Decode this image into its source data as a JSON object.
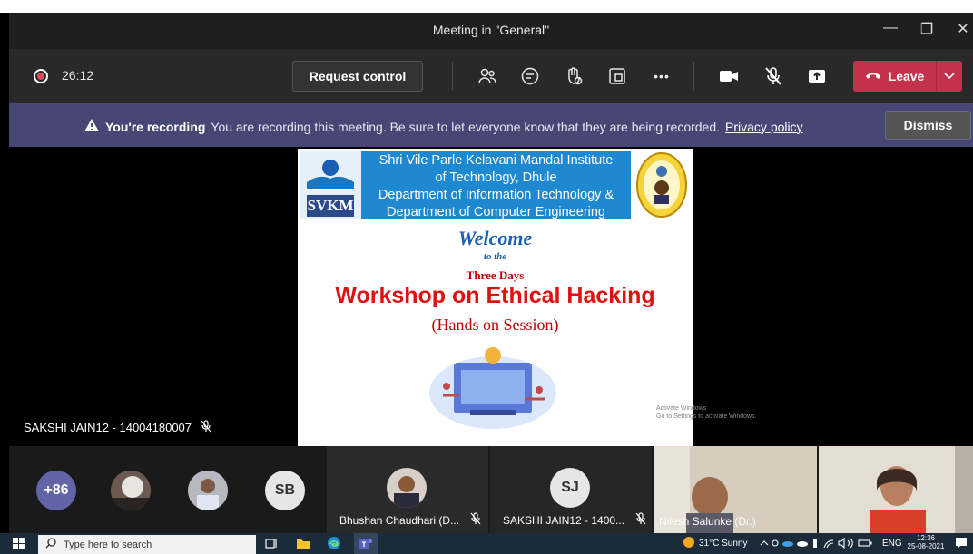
{
  "window": {
    "title": "Meeting in \"General\"",
    "minimize_glyph": "—",
    "maximize_glyph": "❐",
    "close_glyph": "✕"
  },
  "toolbar": {
    "timer": "26:12",
    "request_control_label": "Request control",
    "more_glyph": "•••",
    "leave_label": "Leave",
    "leave_color": "#c4314b",
    "icons": [
      "people-icon",
      "chat-icon",
      "raise-hand-icon",
      "rooms-icon",
      "more-actions-icon",
      "camera-icon",
      "mic-off-icon",
      "share-icon"
    ]
  },
  "recording_banner": {
    "title": "You're recording",
    "message": "You are recording this meeting. Be sure to let everyone know that they are being recorded.",
    "link": "Privacy policy",
    "dismiss_label": "Dismiss",
    "background": "#464775"
  },
  "slide": {
    "logo_text": "SVKM",
    "institute_lines": [
      "Shri Vile Parle Kelavani Mandal  Institute",
      "of Technology, Dhule",
      "Department of Information Technology &",
      "Department of Computer Engineering"
    ],
    "welcome": "Welcome",
    "to_the": "to the",
    "three_days": "Three Days",
    "workshop": "Workshop on Ethical Hacking",
    "hands_on": "(Hands on Session)",
    "watermark_lines": [
      "Activate Windows",
      "Go to Settings to activate Windows."
    ]
  },
  "presenter": {
    "name": "SAKSHI JAIN12 - 14004180007"
  },
  "participants": {
    "overflow_count": "+86",
    "sb_initials": "SB",
    "sj_initials": "SJ",
    "tiles": [
      {
        "name": "Bhushan Chaudhari (D..."
      },
      {
        "name": "SAKSHI JAIN12 - 1400..."
      },
      {
        "name": "Nilesh Salunke (Dr.)"
      }
    ]
  },
  "taskbar": {
    "search_placeholder": "Type here to search",
    "weather": "31°C  Sunny",
    "language": "ENG",
    "time": "12:36",
    "date": "25-08-2021"
  }
}
